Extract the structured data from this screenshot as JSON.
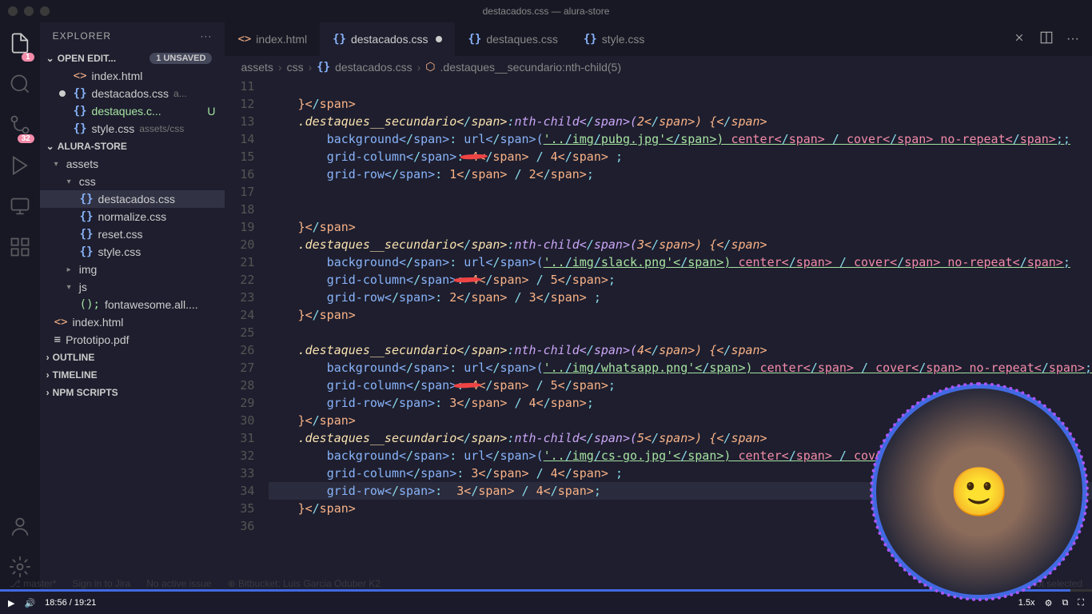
{
  "titlebar": "destacados.css — alura-store",
  "sidebar_title": "EXPLORER",
  "open_editors": {
    "label": "OPEN EDIT...",
    "unsaved": "1 UNSAVED"
  },
  "open_files": [
    {
      "icon": "<>",
      "name": "index.html"
    },
    {
      "icon": "{}",
      "name": "destacados.css",
      "suffix": "a...",
      "modified": true
    },
    {
      "icon": "{}",
      "name": "destaques.c...",
      "git": "U",
      "green": true
    },
    {
      "icon": "{}",
      "name": "style.css",
      "suffix": "assets/css"
    }
  ],
  "project_name": "ALURA-STORE",
  "tree": {
    "assets": "assets",
    "css": "css",
    "css_files": [
      "destacados.css",
      "normalize.css",
      "reset.css",
      "style.css"
    ],
    "img": "img",
    "js": "js",
    "js_files": [
      "fontawesome.all...."
    ],
    "root_files": [
      {
        "icon": "<>",
        "name": "index.html"
      },
      {
        "icon": "≡",
        "name": "Prototipo.pdf"
      }
    ]
  },
  "sections": [
    "OUTLINE",
    "TIMELINE",
    "NPM SCRIPTS"
  ],
  "tabs": [
    {
      "icon": "<>",
      "label": "index.html"
    },
    {
      "icon": "{}",
      "label": "destacados.css",
      "active": true,
      "dirty": true
    },
    {
      "icon": "{}",
      "label": "destaques.css"
    },
    {
      "icon": "{}",
      "label": "style.css"
    }
  ],
  "breadcrumb": {
    "parts": [
      "assets",
      "css",
      "destacados.css",
      ".destaques__secundario:nth-child(5)"
    ]
  },
  "activity_badges": {
    "explorer": "1",
    "scm": "32"
  },
  "video": {
    "time": "18:56  /  19:21",
    "speed": "1.5x"
  },
  "status_faded": [
    "master*",
    "Sign in to Jira",
    "No active issue",
    "Bitbucket: Luis Garcia Oduber K2",
    "Live Share",
    "Server not selected"
  ],
  "code": {
    "lines": [
      {
        "n": 11,
        "t": ""
      },
      {
        "n": 12,
        "t": "    }"
      },
      {
        "n": 13,
        "t": "    .destaques__secundario:nth-child(2) {"
      },
      {
        "n": 14,
        "t": "        background: url('../img/pubg.jpg') center / cover no-repeat;;"
      },
      {
        "n": 15,
        "t": "        grid-column: 4 / 4 ;",
        "scribble": true
      },
      {
        "n": 16,
        "t": "        grid-row: 1 / 2;"
      },
      {
        "n": 17,
        "t": ""
      },
      {
        "n": 18,
        "t": ""
      },
      {
        "n": 19,
        "t": "    }"
      },
      {
        "n": 20,
        "t": "    .destaques__secundario:nth-child(3) {"
      },
      {
        "n": 21,
        "t": "        background: url('../img/slack.png') center / cover no-repeat;"
      },
      {
        "n": 22,
        "t": "        grid-column: 4 / 5;",
        "scribble": true
      },
      {
        "n": 23,
        "t": "        grid-row: 2 / 3 ;"
      },
      {
        "n": 24,
        "t": "    }"
      },
      {
        "n": 25,
        "t": ""
      },
      {
        "n": 26,
        "t": "    .destaques__secundario:nth-child(4) {"
      },
      {
        "n": 27,
        "t": "        background: url('../img/whatsapp.png') center / cover no-repeat;"
      },
      {
        "n": 28,
        "t": "        grid-column: 4 / 5;",
        "scribble": true
      },
      {
        "n": 29,
        "t": "        grid-row: 3 / 4;"
      },
      {
        "n": 30,
        "t": "    }"
      },
      {
        "n": 31,
        "t": "    .destaques__secundario:nth-child(5) {"
      },
      {
        "n": 32,
        "t": "        background: url('../img/cs-go.jpg') center / cover no-repeat;"
      },
      {
        "n": 33,
        "t": "        grid-column: 3 / 4 ;"
      },
      {
        "n": 34,
        "t": "        grid-row:  3 / 4;",
        "current": true
      },
      {
        "n": 35,
        "t": "    }"
      },
      {
        "n": 36,
        "t": ""
      }
    ]
  }
}
